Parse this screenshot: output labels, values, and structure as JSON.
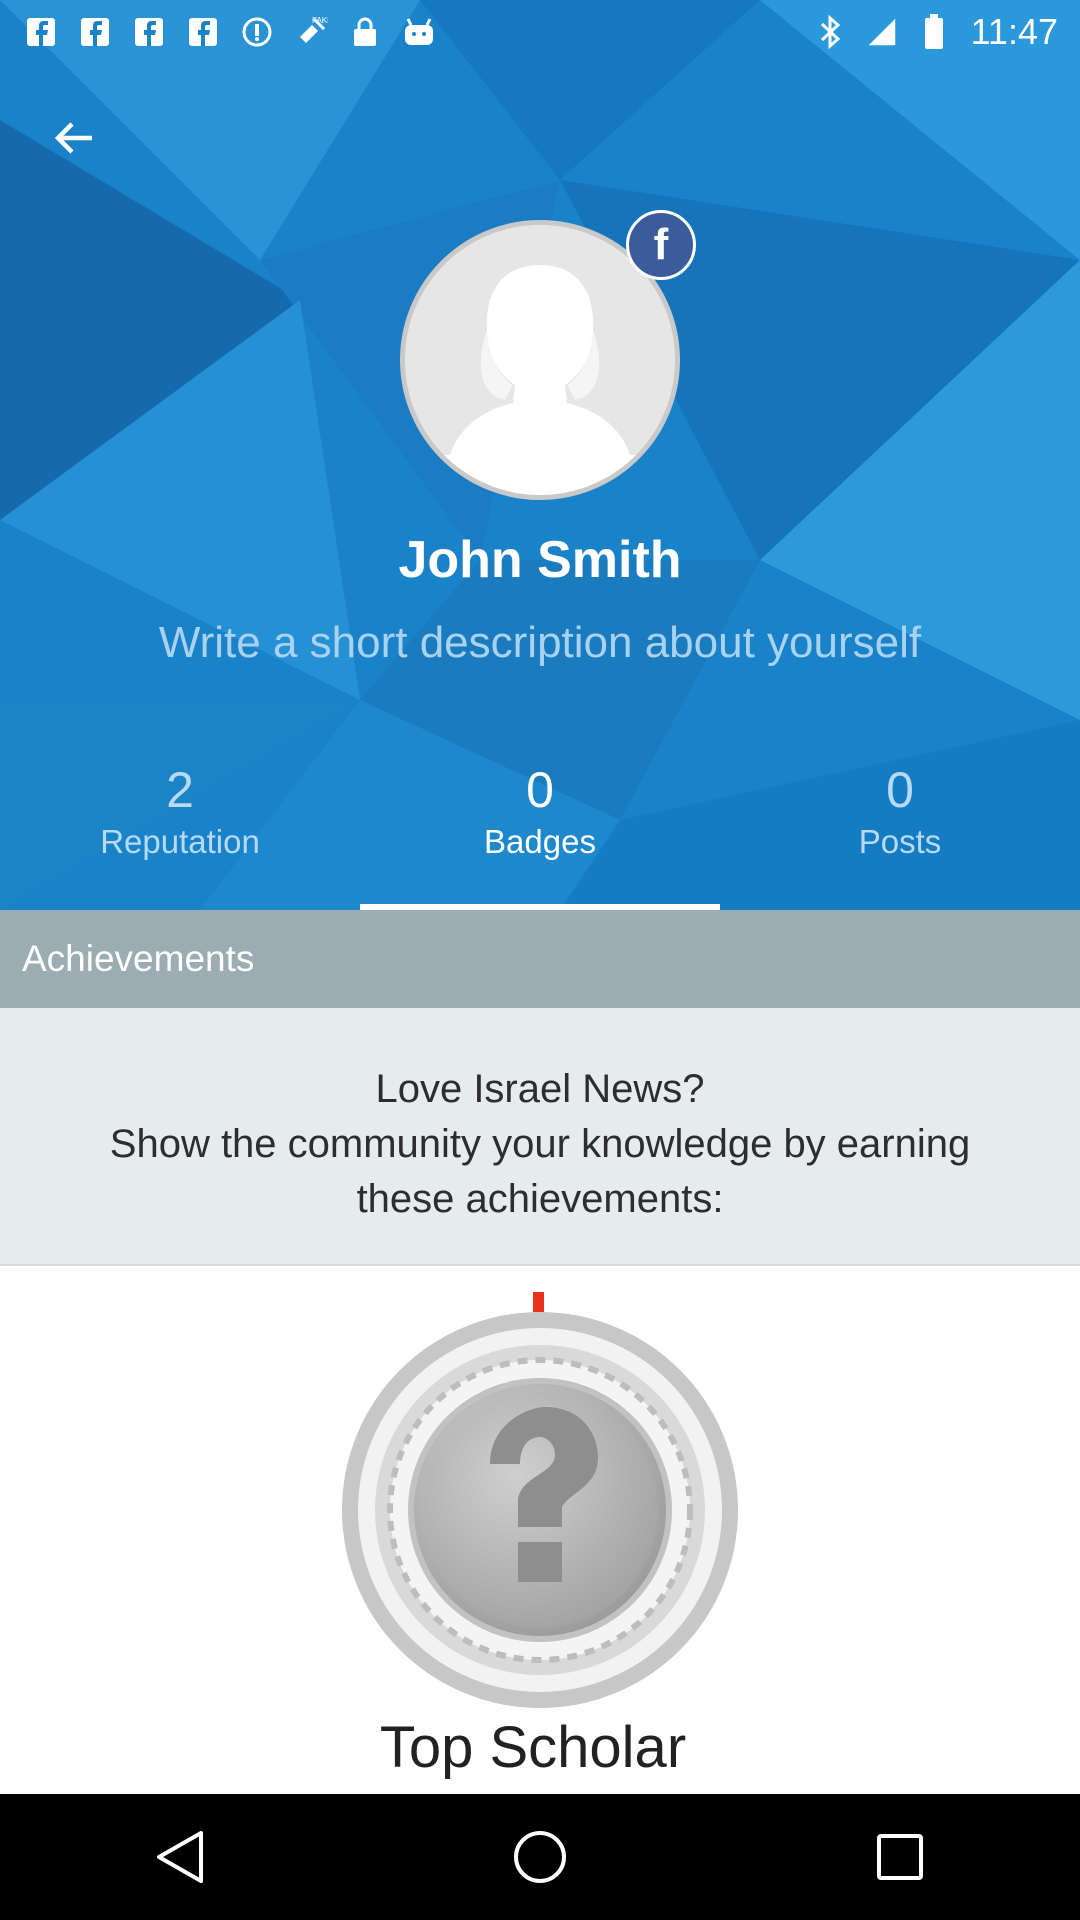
{
  "status_bar": {
    "time": "11:47",
    "left_icons": [
      "facebook-notification-icon",
      "facebook-notification-icon",
      "facebook-notification-icon",
      "facebook-notification-icon",
      "radio-icon",
      "fake-gps-icon",
      "lock-icon",
      "android-icon"
    ],
    "right_icons": [
      "bluetooth-icon",
      "signal-icon",
      "battery-icon"
    ]
  },
  "profile": {
    "name": "John Smith",
    "description_placeholder": "Write a short description about yourself",
    "social_badge": "f"
  },
  "stats": [
    {
      "value": "2",
      "label": "Reputation"
    },
    {
      "value": "0",
      "label": "Badges"
    },
    {
      "value": "0",
      "label": "Posts"
    }
  ],
  "active_tab": "Badges",
  "section": {
    "title": "Achievements"
  },
  "intro": {
    "line1": "Love Israel News?",
    "line2": "Show the community your knowledge by earning these achievements:"
  },
  "achievement": {
    "title": "Top Scholar",
    "symbol": "?"
  },
  "colors": {
    "header_blue": "#1a82c9",
    "section_bar": "#9badb3",
    "intro_bg": "#e6ecee",
    "facebook": "#3b5b9a",
    "progress_red": "#e8321c"
  }
}
